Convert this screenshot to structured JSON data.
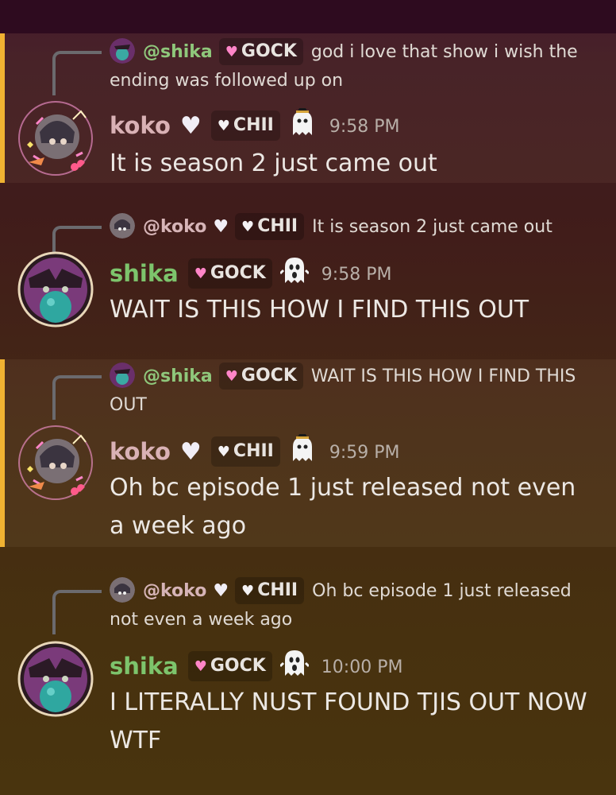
{
  "messages": [
    {
      "author": "koko",
      "author_color": "#d9b1b5",
      "tag": "CHII",
      "time": "9:58 PM",
      "text": "It is season 2 just came out",
      "reply": {
        "name": "@shika",
        "tag": "GOCK",
        "text": "god i love that show i wish the ending was followed up on"
      }
    },
    {
      "author": "shika",
      "author_color": "#7dc46c",
      "tag": "GOCK",
      "time": "9:58 PM",
      "text": "WAIT IS THIS HOW I FIND THIS OUT",
      "reply": {
        "name": "@koko",
        "tag": "CHII",
        "text": "It is season 2 just came out"
      }
    },
    {
      "author": "koko",
      "author_color": "#d9b1b5",
      "tag": "CHII",
      "time": "9:59 PM",
      "text": "Oh bc episode 1 just released not even a week ago",
      "reply": {
        "name": "@shika",
        "tag": "GOCK",
        "text": "WAIT IS THIS HOW I FIND THIS OUT"
      }
    },
    {
      "author": "shika",
      "author_color": "#7dc46c",
      "tag": "GOCK",
      "time": "10:00 PM",
      "text": "I LITERALLY NUST FOUND TJIS OUT NOW WTF",
      "reply": {
        "name": "@koko",
        "tag": "CHII",
        "text": "Oh bc episode 1 just released not even a week ago"
      }
    }
  ],
  "icons": {
    "heart": "white-heart-icon",
    "ghost": "ghost-icon",
    "tag_pink": "pink-heart-icon",
    "tag_white": "white-heart-icon"
  },
  "colors": {
    "highlight_bar": "#f0b232",
    "mention_green": "#8fc77b"
  }
}
